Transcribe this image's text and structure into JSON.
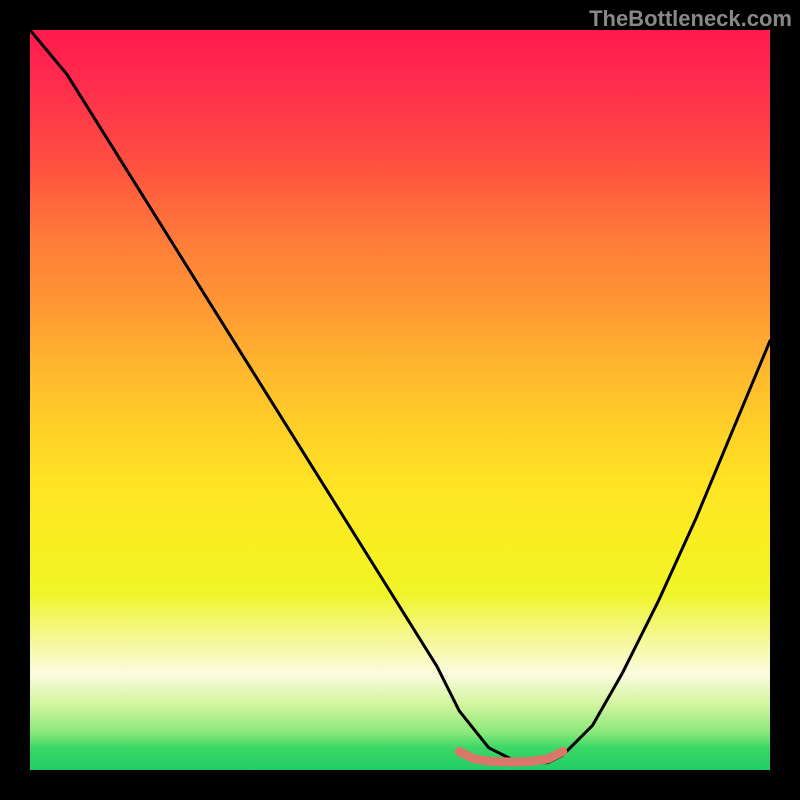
{
  "watermark": "TheBottleneck.com",
  "chart_data": {
    "type": "line",
    "title": "",
    "xlabel": "",
    "ylabel": "",
    "xlim": [
      0,
      100
    ],
    "ylim": [
      0,
      100
    ],
    "grid": false,
    "legend": false,
    "series": [
      {
        "name": "bottleneck-curve",
        "color": "#000000",
        "x": [
          0,
          5,
          10,
          15,
          20,
          25,
          30,
          35,
          40,
          45,
          50,
          55,
          58,
          62,
          66,
          70,
          72,
          76,
          80,
          85,
          90,
          95,
          100
        ],
        "y": [
          100,
          94,
          86,
          78,
          70,
          62,
          54,
          46,
          38,
          30,
          22,
          14,
          8,
          3,
          1,
          1,
          2,
          6,
          13,
          23,
          34,
          46,
          58
        ]
      },
      {
        "name": "optimal-range-marker",
        "color": "#d9776a",
        "x": [
          58,
          60,
          62,
          64,
          66,
          68,
          70,
          72
        ],
        "y": [
          2.5,
          1.5,
          1.2,
          1.1,
          1.1,
          1.2,
          1.5,
          2.5
        ]
      }
    ],
    "colors": {
      "gradient_top": "#ff1a4d",
      "gradient_mid": "#ffe524",
      "gradient_bottom": "#22cc66",
      "curve": "#000000",
      "marker": "#d9776a",
      "background": "#000000"
    }
  }
}
